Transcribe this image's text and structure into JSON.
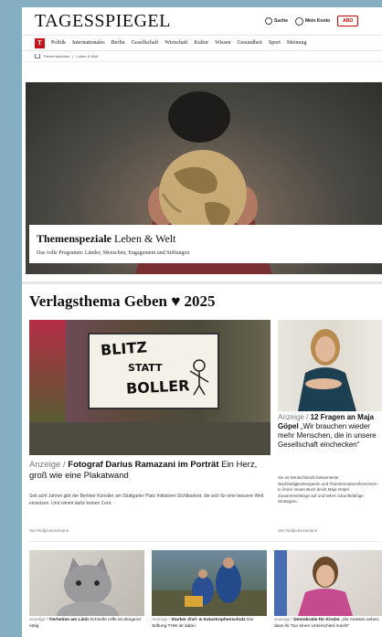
{
  "header": {
    "logo": "TAGESSPIEGEL",
    "search_label": "Suche",
    "account_label": "Mein Konto",
    "abo_label": "ABO"
  },
  "nav": {
    "badge": "T",
    "items": [
      "Politik",
      "Internationales",
      "Berlin",
      "Gesellschaft",
      "Wirtschaft",
      "Kultur",
      "Wissen",
      "Gesundheit",
      "Sport",
      "Meinung"
    ]
  },
  "breadcrumb": [
    "Themenspeziale",
    "Leben & Welt"
  ],
  "hero": {
    "title_bold": "Themenspeziale",
    "title_rest": "Leben & Welt",
    "subtitle": "Das volle Programm: Länder, Menschen, Engagement und Stiftungen"
  },
  "section": {
    "title": "Verlagsthema Geben ♥ 2025"
  },
  "lead": {
    "poster_line1": "BLITZ",
    "poster_line2": "STATT",
    "poster_line3": "BOLLER",
    "label": "Anzeige /",
    "title": "Fotograf Darius Ramazani im Porträt",
    "title_rest": "Ein Herz, groß wie eine Plakatwand",
    "teaser": "Seit acht Jahren gibt der Berliner Künstler am Stuttgarter Platz Initiativen Sichtbarkeit, die sich für eine bessere Welt einsetzen. Und nimmt dafür keinen Cent.",
    "byline": "Von Nadja Bossmann"
  },
  "side": {
    "label": "Anzeige /",
    "title": "12 Fragen an Maja Göpel",
    "title_rest": "„Wir brauchen wieder mehr Menschen, die in unsere Gesellschaft einchecken“",
    "teaser": "Sie ist Deutschlands bekannteste Nachhaltigkeitsexpertin und Transformationsforscherin. In ihrem neuen Buch deckt Maja Göpel Zusammenhänge auf und liefert zukunftsfähige Strategien.",
    "byline": "Von Nadja Bossmann"
  },
  "cards": [
    {
      "label": "Anzeige /",
      "title": "Tierheime am Limit",
      "rest": "Schnelle Hilfe ist dringend nötig"
    },
    {
      "label": "Anzeige /",
      "title": "Starker Zivil- & Katastrophenschutz",
      "rest": "Die Stiftung THW ist dabei"
    },
    {
      "label": "Anzeige /",
      "title": "Demokratie für Kinder",
      "rest": "„Sie müssen sehen, dass ihr Tun einen Unterschied macht“"
    }
  ]
}
